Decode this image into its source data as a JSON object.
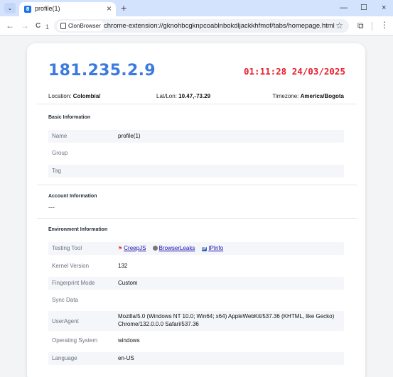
{
  "browser": {
    "tab_menu_glyph": "⌄",
    "tab": {
      "favicon_letter": "8",
      "title": "profile(1)",
      "close_glyph": "×"
    },
    "new_tab_glyph": "+",
    "window": {
      "minimize": "—",
      "maximize": "☐",
      "close": "×"
    },
    "nav": {
      "back": "←",
      "forward": "→",
      "reload": "C",
      "info_badge": "1"
    },
    "chip_label": "ClonBrowser",
    "url": "chrome-extension://gknohbcgknpcoablnbokdljackkhfmof/tabs/homepage.html",
    "star_glyph": "☆",
    "extensions_glyph": "⧉",
    "menu_glyph": "⋮"
  },
  "header": {
    "ip": "181.235.2.9",
    "datetime": "01:11:28 24/03/2025",
    "location_label": "Location:",
    "location_value": "Colombia/",
    "latlon_label": "Lat/Lon:",
    "latlon_value": "10.47,-73.29",
    "timezone_label": "Timezone:",
    "timezone_value": "America/Bogota"
  },
  "basic": {
    "title": "Basic Information",
    "rows": [
      {
        "key": "Name",
        "value": "profile(1)"
      },
      {
        "key": "Group",
        "value": ""
      },
      {
        "key": "Tag",
        "value": ""
      }
    ]
  },
  "account": {
    "title": "Account Information",
    "value": "---"
  },
  "environment": {
    "title": "Environment Information",
    "testing_tool": {
      "key": "Testing Tool",
      "links": [
        {
          "label": "CreepJS",
          "icon": "creepjs-icon"
        },
        {
          "label": "BrowserLeaks",
          "icon": "browserleaks-icon"
        },
        {
          "label": "IPInfo",
          "icon": "ipinfo-icon",
          "icon_text": "IP"
        }
      ]
    },
    "rows": [
      {
        "key": "Kernel Version",
        "value": "132"
      },
      {
        "key": "Fingerprint Mode",
        "value": "Custom"
      },
      {
        "key": "Sync Data",
        "value": ""
      },
      {
        "key": "UserAgent",
        "value": "Mozilla/5.0 (Windows NT 10.0; Win64; x64) AppleWebKit/537.36 (KHTML, like Gecko) Chrome/132.0.0.0 Safari/537.36"
      },
      {
        "key": "Operating System",
        "value": "windows"
      },
      {
        "key": "Language",
        "value": "en-US"
      }
    ]
  },
  "colors": {
    "ip": "#3b7be0",
    "clock": "#e8212e",
    "link": "#1a0dab",
    "tabstrip": "#d3e3fd"
  }
}
